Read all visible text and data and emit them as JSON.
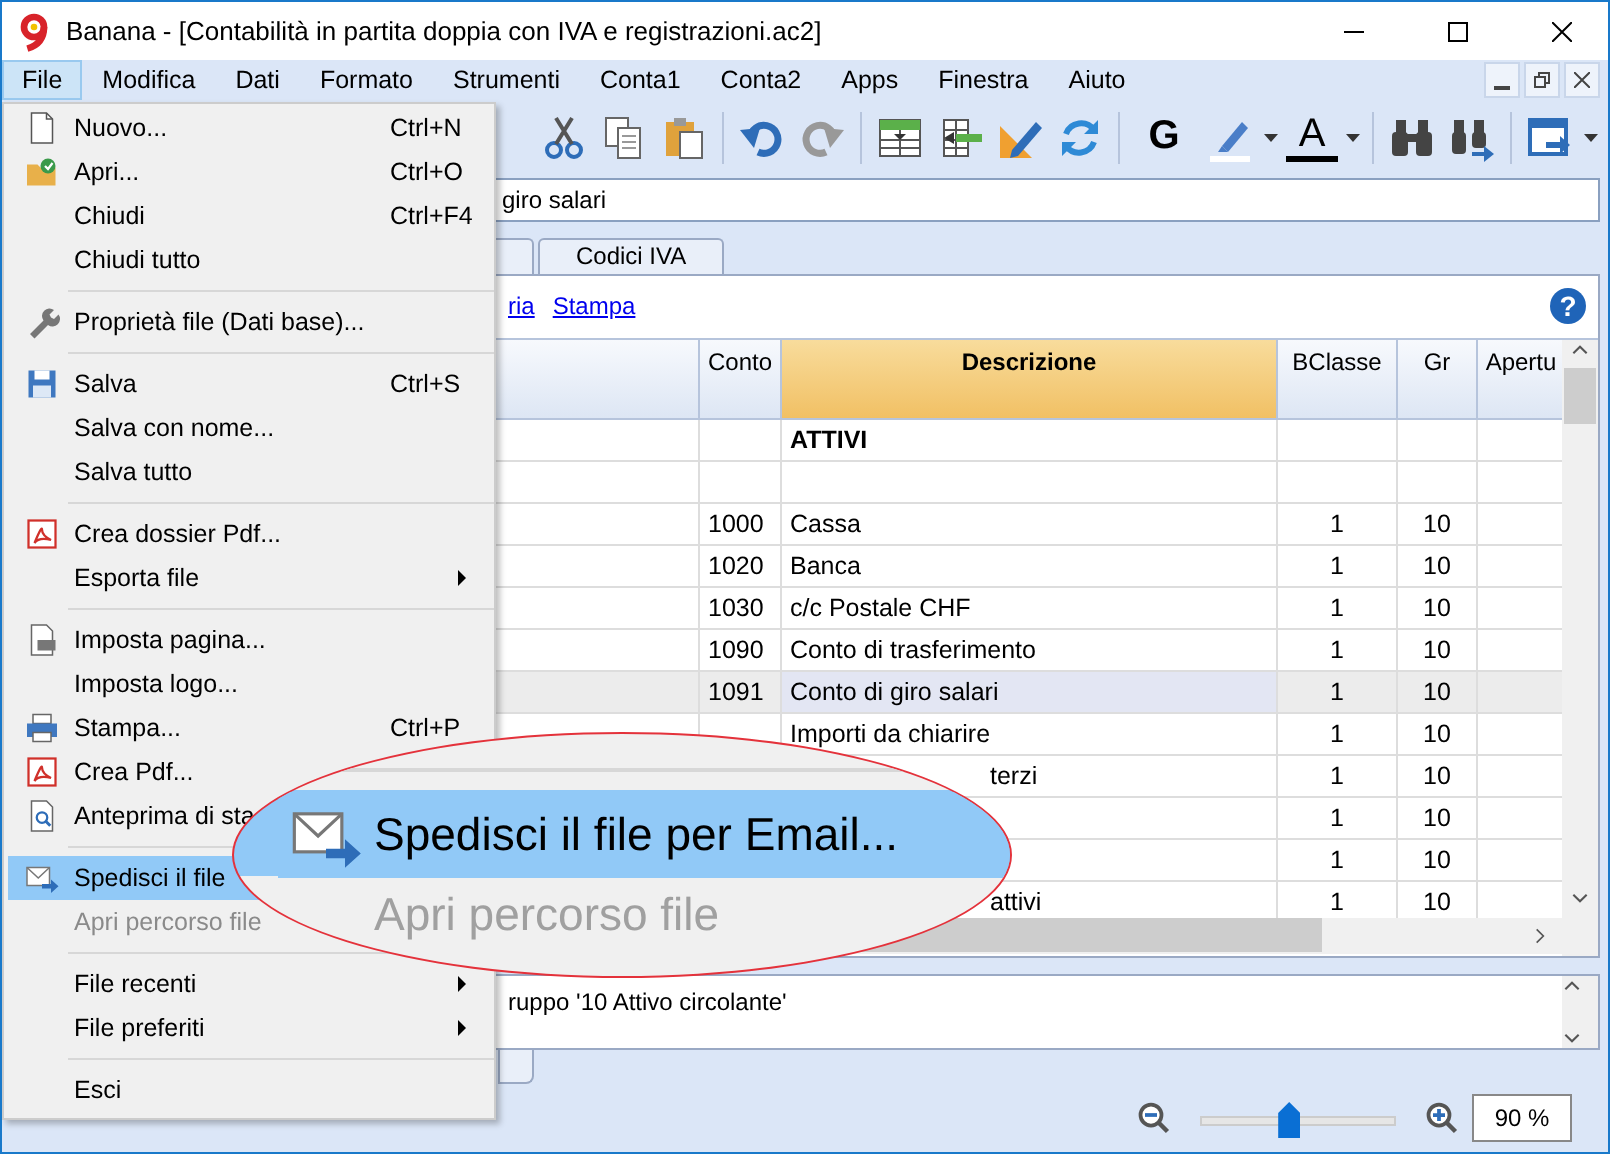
{
  "window": {
    "title": "Banana - [Contabilità in partita doppia con IVA e registrazioni.ac2]"
  },
  "menubar": [
    {
      "label": "File",
      "selected": true
    },
    {
      "label": "Modifica",
      "selected": false
    },
    {
      "label": "Dati",
      "selected": false
    },
    {
      "label": "Formato",
      "selected": false
    },
    {
      "label": "Strumenti",
      "selected": false
    },
    {
      "label": "Conta1",
      "selected": false
    },
    {
      "label": "Conta2",
      "selected": false
    },
    {
      "label": "Apps",
      "selected": false
    },
    {
      "label": "Finestra",
      "selected": false
    },
    {
      "label": "Aiuto",
      "selected": false
    }
  ],
  "toolbar": {
    "text_buttons": [
      {
        "label": "G"
      },
      {
        "label": "A"
      }
    ]
  },
  "cell_field": {
    "value": "giro salari"
  },
  "tabs": [
    {
      "label": "Codici IVA",
      "selected": false
    }
  ],
  "links": [
    "ria",
    "Stampa"
  ],
  "help_button": "?",
  "table": {
    "columns": [
      {
        "label": "Conto",
        "selected": false
      },
      {
        "label": "Descrizione",
        "selected": true
      },
      {
        "label": "BClasse",
        "selected": false
      },
      {
        "label": "Gr",
        "selected": false
      },
      {
        "label": "Apertu",
        "selected": false
      }
    ],
    "rows": [
      {
        "kind": "group",
        "selected": false,
        "cells": [
          "",
          "ATTIVI",
          "",
          "",
          ""
        ]
      },
      {
        "kind": "blank",
        "selected": false,
        "cells": [
          "",
          "",
          "",
          "",
          ""
        ]
      },
      {
        "kind": "account",
        "selected": false,
        "cells": [
          "1000",
          "Cassa",
          "1",
          "10",
          ""
        ]
      },
      {
        "kind": "account",
        "selected": false,
        "cells": [
          "1020",
          "Banca",
          "1",
          "10",
          ""
        ]
      },
      {
        "kind": "account",
        "selected": false,
        "cells": [
          "1030",
          "c/c Postale CHF",
          "1",
          "10",
          ""
        ]
      },
      {
        "kind": "account",
        "selected": false,
        "cells": [
          "1090",
          "Conto di trasferimento",
          "1",
          "10",
          ""
        ]
      },
      {
        "kind": "account",
        "selected": true,
        "cells": [
          "1091",
          "Conto di giro salari",
          "1",
          "10",
          ""
        ]
      },
      {
        "kind": "account",
        "selected": false,
        "cells": [
          "",
          "Importi da chiarire",
          "1",
          "10",
          ""
        ]
      },
      {
        "kind": "covered",
        "selected": false,
        "cells": [
          "",
          "terzi",
          "1",
          "10",
          ""
        ]
      },
      {
        "kind": "covered",
        "selected": false,
        "cells": [
          "",
          "",
          "1",
          "10",
          ""
        ]
      },
      {
        "kind": "covered",
        "selected": false,
        "cells": [
          "",
          "",
          "1",
          "10",
          ""
        ]
      },
      {
        "kind": "covered",
        "selected": false,
        "cells": [
          "",
          "attivi",
          "1",
          "10",
          ""
        ]
      }
    ]
  },
  "info_bar": {
    "text": "ruppo '10 Attivo circolante'"
  },
  "status_bar": {
    "zoom": {
      "level": 0.45,
      "value": "90 %"
    }
  },
  "file_menu": {
    "groups": [
      [
        {
          "label": "Nuovo...",
          "shortcut": "Ctrl+N",
          "submenu": false,
          "highlighted": false,
          "disabled": false
        },
        {
          "label": "Apri...",
          "shortcut": "Ctrl+O",
          "submenu": false,
          "highlighted": false,
          "disabled": false
        },
        {
          "label": "Chiudi",
          "shortcut": "Ctrl+F4",
          "submenu": false,
          "highlighted": false,
          "disabled": false
        },
        {
          "label": "Chiudi tutto",
          "submenu": false,
          "highlighted": false,
          "disabled": false
        }
      ],
      [
        {
          "label": "Proprietà file (Dati base)...",
          "submenu": false,
          "highlighted": false,
          "disabled": false
        }
      ],
      [
        {
          "label": "Salva",
          "shortcut": "Ctrl+S",
          "submenu": false,
          "highlighted": false,
          "disabled": false
        },
        {
          "label": "Salva con nome...",
          "submenu": false,
          "highlighted": false,
          "disabled": false
        },
        {
          "label": "Salva tutto",
          "submenu": false,
          "highlighted": false,
          "disabled": false
        }
      ],
      [
        {
          "label": "Crea dossier Pdf...",
          "submenu": false,
          "highlighted": false,
          "disabled": false
        },
        {
          "label": "Esporta file",
          "submenu": true,
          "highlighted": false,
          "disabled": false
        }
      ],
      [
        {
          "label": "Imposta pagina...",
          "submenu": false,
          "highlighted": false,
          "disabled": false
        },
        {
          "label": "Imposta logo...",
          "submenu": false,
          "highlighted": false,
          "disabled": false
        },
        {
          "label": "Stampa...",
          "shortcut": "Ctrl+P",
          "submenu": false,
          "highlighted": false,
          "disabled": false
        },
        {
          "label": "Crea Pdf...",
          "highlighted": false,
          "disabled": false
        },
        {
          "label": "Anteprima di sta",
          "highlighted": false,
          "disabled": false
        }
      ],
      [
        {
          "label": "Spedisci il file",
          "highlighted": true,
          "disabled": false
        },
        {
          "label": "Apri percorso file",
          "highlighted": false,
          "disabled": true
        }
      ],
      [
        {
          "label": "File recenti",
          "submenu": true,
          "highlighted": false,
          "disabled": false
        },
        {
          "label": "File preferiti",
          "submenu": true,
          "highlighted": false,
          "disabled": false
        }
      ],
      [
        {
          "label": "Esci",
          "submenu": false,
          "highlighted": false,
          "disabled": false
        }
      ]
    ]
  },
  "magnifier": {
    "items": [
      {
        "label": "Spedisci il file per Email...",
        "highlighted": true,
        "disabled": false
      },
      {
        "label": "Apri percorso file",
        "highlighted": false,
        "disabled": true
      }
    ]
  }
}
